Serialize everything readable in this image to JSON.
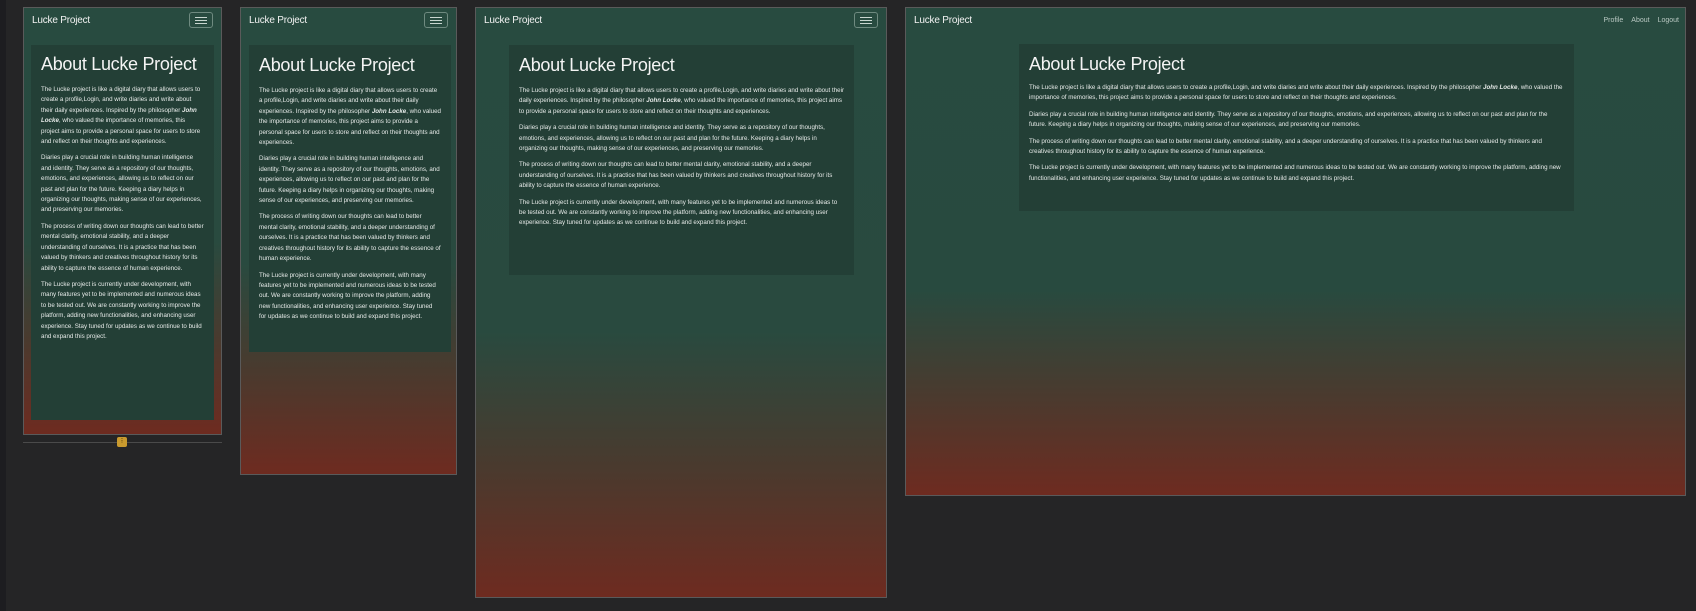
{
  "brand": "Lucke Project",
  "nav_links": [
    "Profile",
    "About",
    "Logout"
  ],
  "heading": "About Lucke Project",
  "paragraphs": {
    "p1_before": "The Lucke project is like a digital diary that allows users to create a profile,Login, and write diaries and write about their daily experiences. Inspired by the philosopher ",
    "p1_name": "John Locke",
    "p1_after": ", who valued the importance of memories, this project aims to provide a personal space for users to store and reflect on their thoughts and experiences.",
    "p2": "Diaries play a crucial role in building human intelligence and identity. They serve as a repository of our thoughts, emotions, and experiences, allowing us to reflect on our past and plan for the future. Keeping a diary helps in organizing our thoughts, making sense of our experiences, and preserving our memories.",
    "p3": "The process of writing down our thoughts can lead to better mental clarity, emotional stability, and a deeper understanding of ourselves. It is a practice that has been valued by thinkers and creatives throughout history for its ability to capture the essence of human experience.",
    "p4": "The Lucke project is currently under development, with many features yet to be implemented and numerous ideas to be tested out. We are constantly working to improve the platform, adding new functionalities, and enhancing user experience. Stay tuned for updates as we continue to build and expand this project."
  },
  "colors": {
    "background": "#252526",
    "gradient_top": "#284b40",
    "gradient_bottom": "#6e2b20",
    "card": "#233f36",
    "resize_handle": "#c99a2e"
  },
  "icons": {
    "toggler": "hamburger-menu-icon",
    "resize": "resize-handle-icon"
  }
}
